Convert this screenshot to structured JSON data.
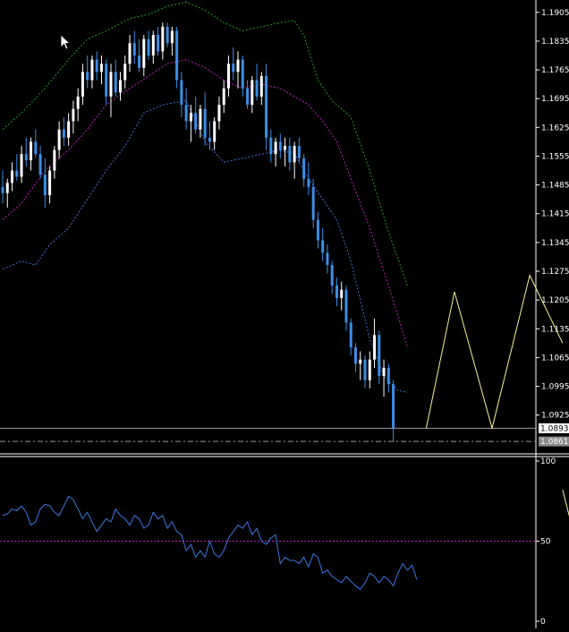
{
  "colors": {
    "background": "#000000",
    "bull_candle": "#ffffff",
    "bear_candle": "#3a8ee6",
    "upper_band": "#22a022",
    "middle_band": "#c020c0",
    "lower_band": "#4a6fd8",
    "forecast": "#f3f39a",
    "indicator": "#3a78e0",
    "level_line": "#c020c0",
    "axis_text": "#ffffff",
    "bid_label_bg": "#ffffff",
    "ask_label_bg": "#8a8a8a"
  },
  "price_axis": {
    "ticks": [
      "1.1905",
      "1.1835",
      "1.1765",
      "1.1695",
      "1.1625",
      "1.1555",
      "1.1485",
      "1.1415",
      "1.1345",
      "1.1275",
      "1.1205",
      "1.1135",
      "1.1065",
      "1.0995",
      "1.0925"
    ],
    "bid_label": "1.0893",
    "ask_label": "1.0861",
    "ylim": [
      1.0835,
      1.1935
    ]
  },
  "indicator_axis": {
    "ticks": [
      "100",
      "50",
      "0"
    ],
    "level": 50,
    "ylim": [
      0,
      100
    ]
  },
  "icons": {
    "cursor": "arrow-cursor-icon"
  },
  "chart_data": [
    {
      "type": "candlestick",
      "ylim": [
        1.0835,
        1.1935
      ],
      "candles": [
        [
          1.148,
          1.152,
          1.144,
          1.1465
        ],
        [
          1.1465,
          1.15,
          1.143,
          1.149
        ],
        [
          1.149,
          1.154,
          1.147,
          1.152
        ],
        [
          1.152,
          1.156,
          1.1495,
          1.1505
        ],
        [
          1.1505,
          1.158,
          1.149,
          1.156
        ],
        [
          1.156,
          1.16,
          1.153,
          1.1545
        ],
        [
          1.1545,
          1.16,
          1.152,
          1.159
        ],
        [
          1.159,
          1.162,
          1.155,
          1.156
        ],
        [
          1.156,
          1.158,
          1.15,
          1.151
        ],
        [
          1.151,
          1.155,
          1.143,
          1.146
        ],
        [
          1.146,
          1.153,
          1.144,
          1.152
        ],
        [
          1.152,
          1.158,
          1.15,
          1.157
        ],
        [
          1.157,
          1.164,
          1.155,
          1.162
        ],
        [
          1.162,
          1.165,
          1.158,
          1.16
        ],
        [
          1.16,
          1.166,
          1.158,
          1.164
        ],
        [
          1.164,
          1.169,
          1.161,
          1.167
        ],
        [
          1.167,
          1.172,
          1.164,
          1.17
        ],
        [
          1.17,
          1.178,
          1.168,
          1.176
        ],
        [
          1.176,
          1.18,
          1.172,
          1.174
        ],
        [
          1.174,
          1.18,
          1.172,
          1.179
        ],
        [
          1.179,
          1.181,
          1.174,
          1.176
        ],
        [
          1.176,
          1.18,
          1.173,
          1.178
        ],
        [
          1.178,
          1.179,
          1.168,
          1.17
        ],
        [
          1.17,
          1.178,
          1.165,
          1.176
        ],
        [
          1.176,
          1.179,
          1.17,
          1.171
        ],
        [
          1.171,
          1.176,
          1.169,
          1.174
        ],
        [
          1.174,
          1.18,
          1.172,
          1.178
        ],
        [
          1.178,
          1.185,
          1.176,
          1.183
        ],
        [
          1.183,
          1.186,
          1.178,
          1.18
        ],
        [
          1.18,
          1.184,
          1.176,
          1.177
        ],
        [
          1.177,
          1.185,
          1.175,
          1.184
        ],
        [
          1.184,
          1.186,
          1.179,
          1.18
        ],
        [
          1.18,
          1.186,
          1.178,
          1.185
        ],
        [
          1.185,
          1.187,
          1.18,
          1.181
        ],
        [
          1.181,
          1.188,
          1.179,
          1.187
        ],
        [
          1.187,
          1.188,
          1.182,
          1.183
        ],
        [
          1.183,
          1.187,
          1.18,
          1.186
        ],
        [
          1.186,
          1.187,
          1.172,
          1.174
        ],
        [
          1.174,
          1.176,
          1.165,
          1.168
        ],
        [
          1.168,
          1.172,
          1.162,
          1.164
        ],
        [
          1.164,
          1.168,
          1.159,
          1.166
        ],
        [
          1.166,
          1.17,
          1.161,
          1.162
        ],
        [
          1.162,
          1.168,
          1.16,
          1.167
        ],
        [
          1.167,
          1.171,
          1.158,
          1.16
        ],
        [
          1.16,
          1.164,
          1.157,
          1.159
        ],
        [
          1.159,
          1.165,
          1.157,
          1.164
        ],
        [
          1.164,
          1.17,
          1.162,
          1.168
        ],
        [
          1.168,
          1.174,
          1.166,
          1.172
        ],
        [
          1.172,
          1.18,
          1.17,
          1.178
        ],
        [
          1.178,
          1.182,
          1.174,
          1.176
        ],
        [
          1.176,
          1.181,
          1.172,
          1.179
        ],
        [
          1.179,
          1.18,
          1.17,
          1.172
        ],
        [
          1.172,
          1.174,
          1.167,
          1.168
        ],
        [
          1.168,
          1.175,
          1.166,
          1.174
        ],
        [
          1.174,
          1.178,
          1.169,
          1.17
        ],
        [
          1.17,
          1.176,
          1.168,
          1.175
        ],
        [
          1.175,
          1.178,
          1.157,
          1.16
        ],
        [
          1.16,
          1.162,
          1.154,
          1.156
        ],
        [
          1.156,
          1.16,
          1.153,
          1.159
        ],
        [
          1.159,
          1.161,
          1.155,
          1.157
        ],
        [
          1.157,
          1.16,
          1.153,
          1.158
        ],
        [
          1.158,
          1.16,
          1.152,
          1.154
        ],
        [
          1.154,
          1.159,
          1.15,
          1.158
        ],
        [
          1.158,
          1.16,
          1.154,
          1.155
        ],
        [
          1.155,
          1.156,
          1.148,
          1.15
        ],
        [
          1.15,
          1.154,
          1.146,
          1.148
        ],
        [
          1.148,
          1.15,
          1.138,
          1.14
        ],
        [
          1.14,
          1.142,
          1.133,
          1.135
        ],
        [
          1.135,
          1.138,
          1.13,
          1.132
        ],
        [
          1.132,
          1.134,
          1.127,
          1.129
        ],
        [
          1.129,
          1.13,
          1.122,
          1.124
        ],
        [
          1.124,
          1.126,
          1.119,
          1.121
        ],
        [
          1.121,
          1.125,
          1.118,
          1.123
        ],
        [
          1.123,
          1.124,
          1.113,
          1.115
        ],
        [
          1.115,
          1.116,
          1.107,
          1.109
        ],
        [
          1.109,
          1.11,
          1.103,
          1.105
        ],
        [
          1.105,
          1.108,
          1.101,
          1.106
        ],
        [
          1.106,
          1.107,
          1.099,
          1.101
        ],
        [
          1.101,
          1.108,
          1.099,
          1.106
        ],
        [
          1.106,
          1.116,
          1.104,
          1.112
        ],
        [
          1.112,
          1.113,
          1.1,
          1.102
        ],
        [
          1.102,
          1.106,
          1.097,
          1.104
        ],
        [
          1.104,
          1.105,
          1.098,
          1.1
        ],
        [
          1.1,
          1.101,
          1.0861,
          1.0893
        ]
      ],
      "bands": {
        "upper": [
          [
            0,
            1.162
          ],
          [
            4,
            1.166
          ],
          [
            9,
            1.172
          ],
          [
            14,
            1.179
          ],
          [
            18,
            1.184
          ],
          [
            22,
            1.186
          ],
          [
            27,
            1.189
          ],
          [
            31,
            1.19
          ],
          [
            35,
            1.192
          ],
          [
            39,
            1.193
          ],
          [
            43,
            1.191
          ],
          [
            47,
            1.188
          ],
          [
            51,
            1.186
          ],
          [
            55,
            1.187
          ],
          [
            59,
            1.188
          ],
          [
            62,
            1.1885
          ],
          [
            64,
            1.185
          ],
          [
            67,
            1.174
          ],
          [
            70,
            1.169
          ],
          [
            74,
            1.165
          ],
          [
            78,
            1.152
          ],
          [
            82,
            1.137
          ],
          [
            86,
            1.124
          ]
        ],
        "middle": [
          [
            0,
            1.14
          ],
          [
            4,
            1.144
          ],
          [
            9,
            1.152
          ],
          [
            14,
            1.157
          ],
          [
            18,
            1.162
          ],
          [
            22,
            1.168
          ],
          [
            27,
            1.172
          ],
          [
            31,
            1.175
          ],
          [
            35,
            1.178
          ],
          [
            39,
            1.179
          ],
          [
            43,
            1.177
          ],
          [
            47,
            1.174
          ],
          [
            51,
            1.172
          ],
          [
            55,
            1.173
          ],
          [
            59,
            1.172
          ],
          [
            62,
            1.17
          ],
          [
            65,
            1.168
          ],
          [
            68,
            1.164
          ],
          [
            71,
            1.159
          ],
          [
            74,
            1.15
          ],
          [
            78,
            1.138
          ],
          [
            82,
            1.124
          ],
          [
            86,
            1.109
          ]
        ],
        "lower": [
          [
            0,
            1.128
          ],
          [
            4,
            1.13
          ],
          [
            7,
            1.129
          ],
          [
            10,
            1.134
          ],
          [
            14,
            1.138
          ],
          [
            18,
            1.145
          ],
          [
            22,
            1.152
          ],
          [
            26,
            1.158
          ],
          [
            30,
            1.166
          ],
          [
            34,
            1.168
          ],
          [
            39,
            1.169
          ],
          [
            43,
            1.159
          ],
          [
            47,
            1.154
          ],
          [
            51,
            1.155
          ],
          [
            55,
            1.156
          ],
          [
            59,
            1.157
          ],
          [
            62,
            1.156
          ],
          [
            65,
            1.15
          ],
          [
            68,
            1.145
          ],
          [
            71,
            1.14
          ],
          [
            74,
            1.13
          ],
          [
            78,
            1.111
          ],
          [
            81,
            1.102
          ],
          [
            84,
            1.0985
          ],
          [
            86,
            1.098
          ]
        ]
      },
      "forecast": [
        [
          90,
          1.0893
        ],
        [
          96,
          1.1225
        ],
        [
          104,
          1.0893
        ],
        [
          112,
          1.1265
        ],
        [
          119,
          1.11
        ]
      ],
      "bid": 1.0893,
      "ask": 1.0861
    },
    {
      "type": "line",
      "ylim": [
        0,
        100
      ],
      "level": 50,
      "values": [
        66,
        67,
        70,
        69,
        72,
        68,
        60,
        62,
        70,
        73,
        72,
        68,
        66,
        72,
        78,
        76,
        70,
        64,
        68,
        62,
        56,
        60,
        64,
        62,
        70,
        66,
        64,
        60,
        66,
        64,
        58,
        60,
        68,
        64,
        66,
        58,
        62,
        56,
        54,
        44,
        48,
        40,
        44,
        40,
        50,
        42,
        40,
        44,
        52,
        56,
        60,
        58,
        62,
        54,
        58,
        50,
        48,
        52,
        54,
        36,
        40,
        38,
        38,
        36,
        40,
        34,
        42,
        40,
        30,
        32,
        28,
        26,
        24,
        28,
        25,
        22,
        20,
        24,
        30,
        28,
        24,
        28,
        26,
        22,
        30,
        36,
        32,
        35,
        26
      ],
      "forecast": [
        [
          119,
          82
        ],
        [
          124,
          24
        ]
      ]
    }
  ]
}
